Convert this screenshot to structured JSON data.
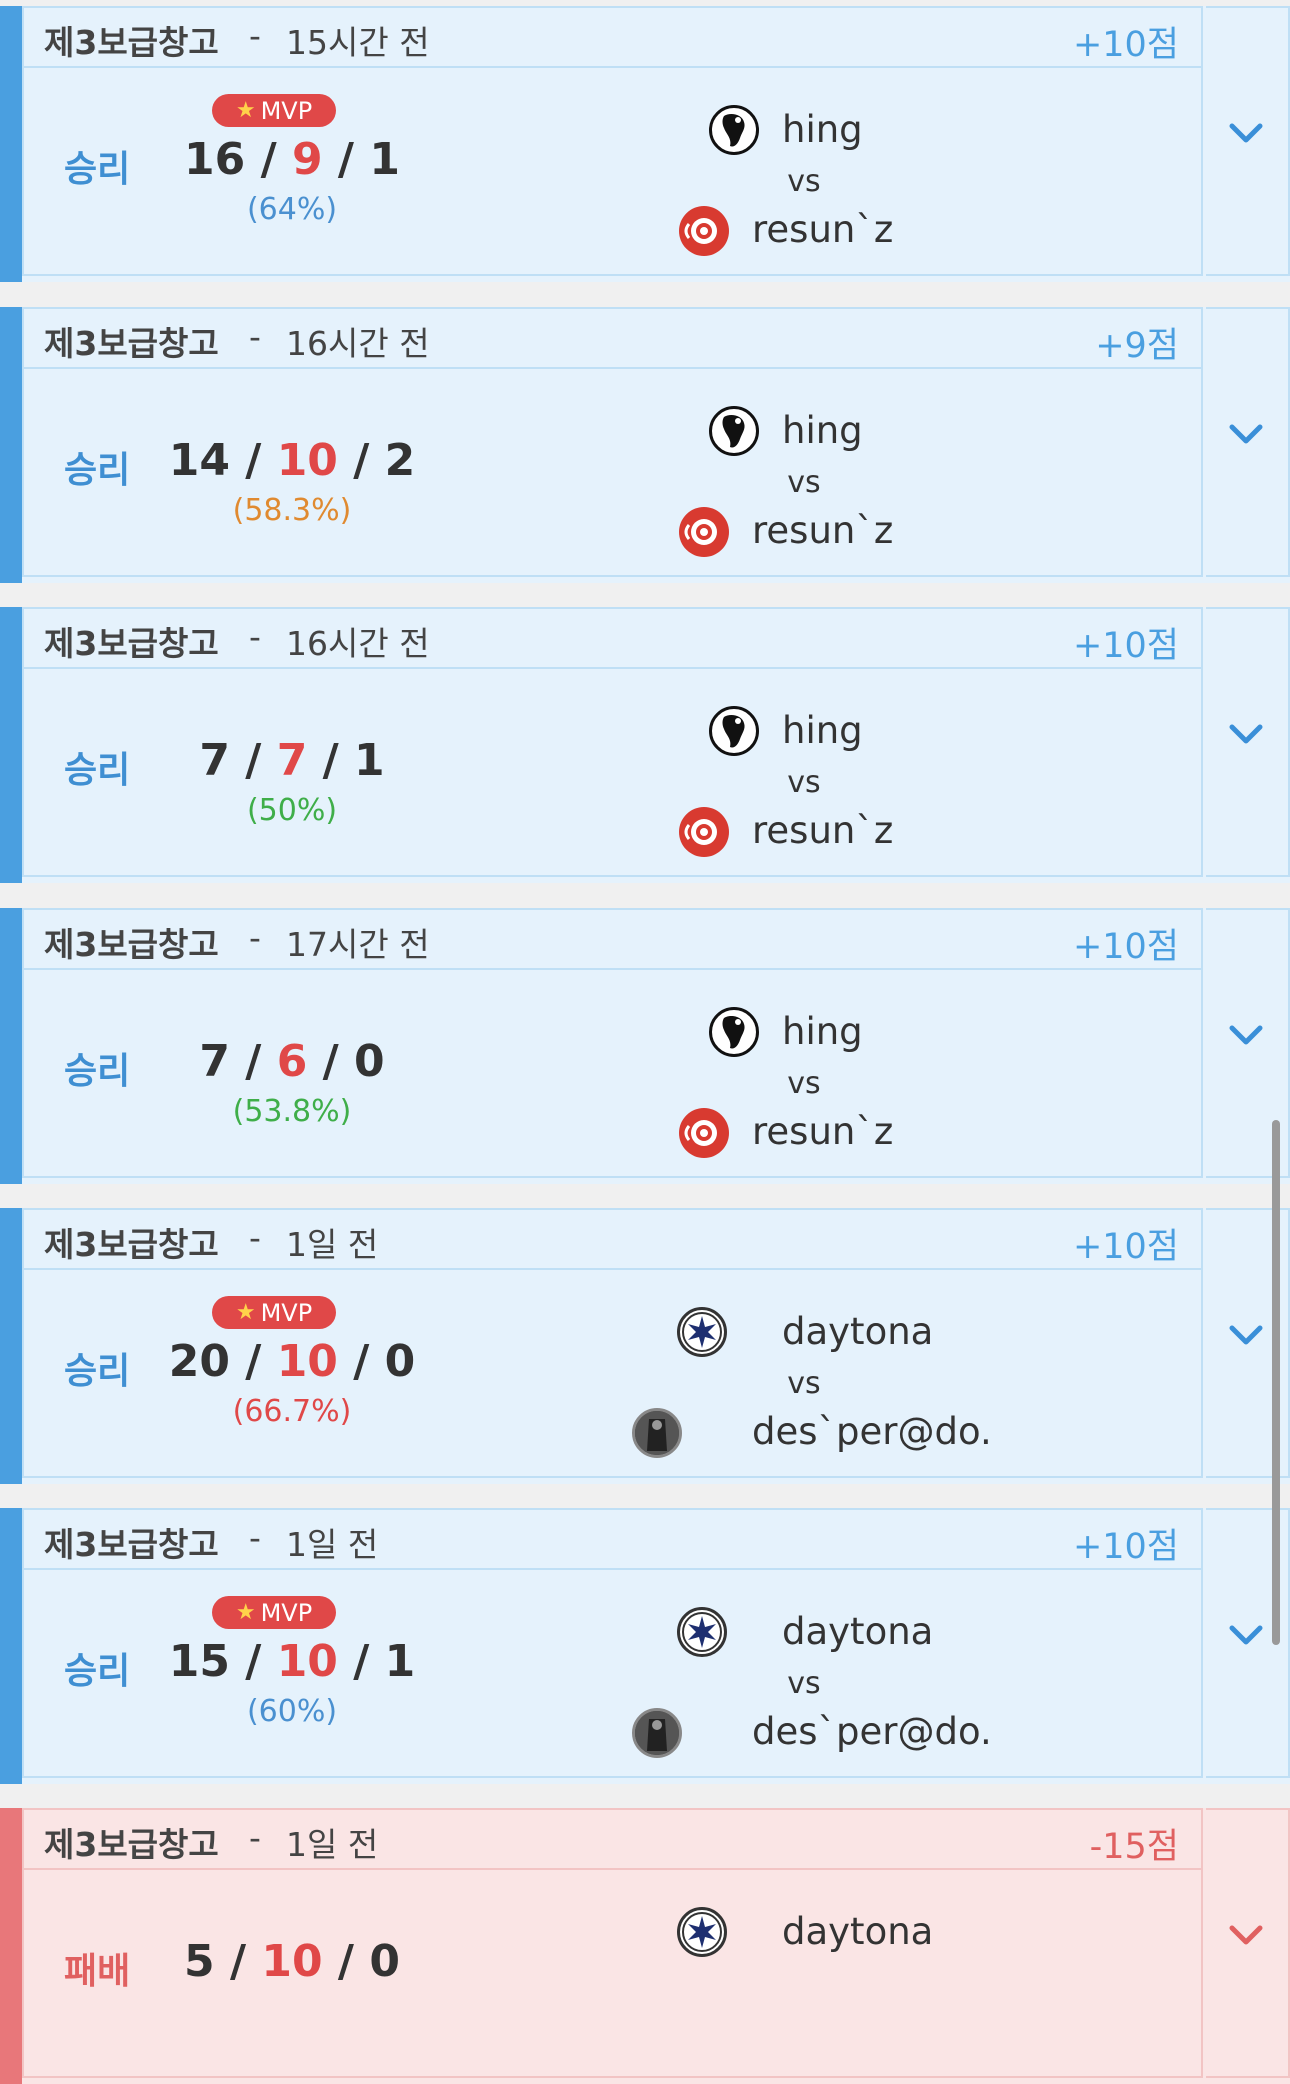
{
  "colors": {
    "win_accent": "#4a9fe0",
    "win_bg": "#e5f2fc",
    "loss_accent": "#e8777a",
    "loss_bg": "#fae5e5",
    "death_red": "#e04848"
  },
  "matches": [
    {
      "map": "제3보급창고",
      "sep": "-",
      "time": "15시간 전",
      "points": "+10점",
      "result": "승리",
      "mvp": true,
      "mvp_label": "MVP",
      "kills": "16",
      "deaths": "9",
      "assists": "1",
      "ratio": "(64%)",
      "ratio_color": "#4a90d0",
      "player1": "hing",
      "vs": "vs",
      "player2": "resun`z",
      "player1_icon": "hing-icon",
      "player2_icon": "resun-icon",
      "outcome": "win"
    },
    {
      "map": "제3보급창고",
      "sep": "-",
      "time": "16시간 전",
      "points": "+9점",
      "result": "승리",
      "mvp": false,
      "mvp_label": "",
      "kills": "14",
      "deaths": "10",
      "assists": "2",
      "ratio": "(58.3%)",
      "ratio_color": "#e08a30",
      "player1": "hing",
      "vs": "vs",
      "player2": "resun`z",
      "player1_icon": "hing-icon",
      "player2_icon": "resun-icon",
      "outcome": "win"
    },
    {
      "map": "제3보급창고",
      "sep": "-",
      "time": "16시간 전",
      "points": "+10점",
      "result": "승리",
      "mvp": false,
      "mvp_label": "",
      "kills": "7",
      "deaths": "7",
      "assists": "1",
      "ratio": "(50%)",
      "ratio_color": "#3fae49",
      "player1": "hing",
      "vs": "vs",
      "player2": "resun`z",
      "player1_icon": "hing-icon",
      "player2_icon": "resun-icon",
      "outcome": "win"
    },
    {
      "map": "제3보급창고",
      "sep": "-",
      "time": "17시간 전",
      "points": "+10점",
      "result": "승리",
      "mvp": false,
      "mvp_label": "",
      "kills": "7",
      "deaths": "6",
      "assists": "0",
      "ratio": "(53.8%)",
      "ratio_color": "#3fae49",
      "player1": "hing",
      "vs": "vs",
      "player2": "resun`z",
      "player1_icon": "hing-icon",
      "player2_icon": "resun-icon",
      "outcome": "win"
    },
    {
      "map": "제3보급창고",
      "sep": "-",
      "time": "1일 전",
      "points": "+10점",
      "result": "승리",
      "mvp": true,
      "mvp_label": "MVP",
      "kills": "20",
      "deaths": "10",
      "assists": "0",
      "ratio": "(66.7%)",
      "ratio_color": "#e04848",
      "player1": "daytona",
      "vs": "vs",
      "player2": "des`per@do.",
      "player1_icon": "daytona-icon",
      "player2_icon": "desperado-icon",
      "outcome": "win"
    },
    {
      "map": "제3보급창고",
      "sep": "-",
      "time": "1일 전",
      "points": "+10점",
      "result": "승리",
      "mvp": true,
      "mvp_label": "MVP",
      "kills": "15",
      "deaths": "10",
      "assists": "1",
      "ratio": "(60%)",
      "ratio_color": "#4a90d0",
      "player1": "daytona",
      "vs": "vs",
      "player2": "des`per@do.",
      "player1_icon": "daytona-icon",
      "player2_icon": "desperado-icon",
      "outcome": "win"
    },
    {
      "map": "제3보급창고",
      "sep": "-",
      "time": "1일 전",
      "points": "-15점",
      "result": "패배",
      "mvp": false,
      "mvp_label": "",
      "kills": "5",
      "deaths": "10",
      "assists": "0",
      "ratio": "",
      "ratio_color": "#e04848",
      "player1": "daytona",
      "vs": "",
      "player2": "",
      "player1_icon": "daytona-icon",
      "player2_icon": "",
      "outcome": "loss"
    }
  ]
}
